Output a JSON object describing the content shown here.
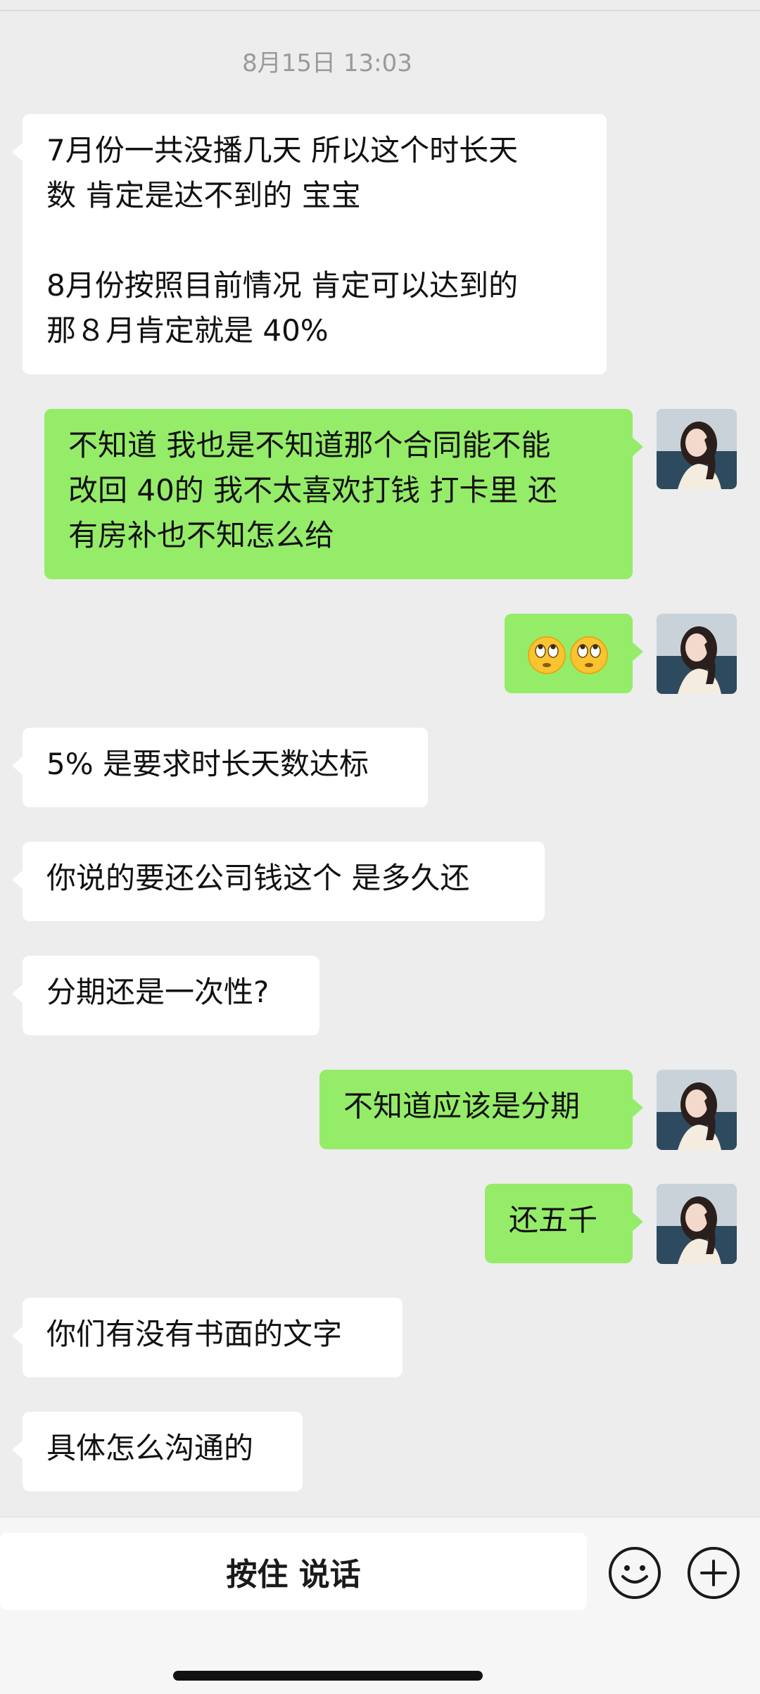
{
  "chat": {
    "timestamp": "8月15日 13:03",
    "messages": [
      {
        "side": "left",
        "lines": [
          "7月份一共没播几天 所以这个时长天",
          "数 肯定是达不到的 宝宝",
          "",
          "8月份按照目前情况 肯定可以达到的",
          "那８月肯定就是 40%"
        ]
      },
      {
        "side": "right",
        "lines": [
          "不知道 我也是不知道那个合同能不能",
          "改回 40的 我不太喜欢打钱 打卡里 还",
          "有房补也不知怎么给"
        ]
      },
      {
        "side": "right",
        "emoji": [
          "rolling-eyes-emoji",
          "rolling-eyes-emoji"
        ]
      },
      {
        "side": "left",
        "lines": [
          "5% 是要求时长天数达标"
        ]
      },
      {
        "side": "left",
        "lines": [
          "你说的要还公司钱这个 是多久还"
        ]
      },
      {
        "side": "left",
        "lines": [
          "分期还是一次性?"
        ]
      },
      {
        "side": "right",
        "lines": [
          "不知道应该是分期"
        ]
      },
      {
        "side": "right",
        "lines": [
          "还五千"
        ]
      },
      {
        "side": "left",
        "lines": [
          "你们有没有书面的文字"
        ]
      },
      {
        "side": "left",
        "lines": [
          "具体怎么沟通的"
        ]
      }
    ]
  },
  "input_bar": {
    "voice_button_label": "按住 说话",
    "emoji_icon": "smiley-face-icon",
    "plus_icon": "plus-circle-icon"
  },
  "colors": {
    "background": "#ededed",
    "bubble_self": "#95ec69",
    "bubble_other": "#ffffff",
    "timestamp_text": "#9a9a9a"
  }
}
